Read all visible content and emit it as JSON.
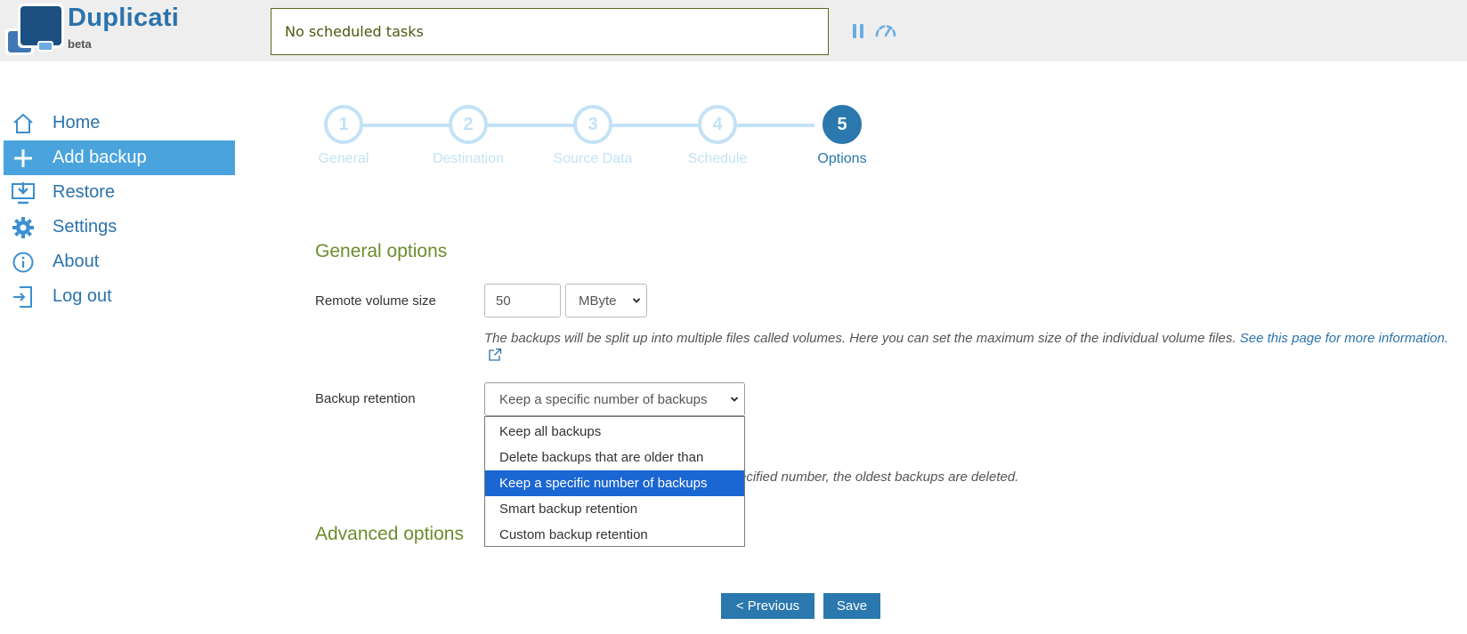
{
  "header": {
    "brand": "Duplicati",
    "brand_sub": "beta",
    "status": "No scheduled tasks"
  },
  "sidebar": {
    "items": [
      {
        "label": "Home",
        "icon": "home-icon"
      },
      {
        "label": "Add backup",
        "icon": "plus-icon",
        "active": true
      },
      {
        "label": "Restore",
        "icon": "restore-icon"
      },
      {
        "label": "Settings",
        "icon": "gear-icon"
      },
      {
        "label": "About",
        "icon": "info-icon"
      },
      {
        "label": "Log out",
        "icon": "logout-icon"
      }
    ]
  },
  "steps": [
    {
      "number": "1",
      "label": "General"
    },
    {
      "number": "2",
      "label": "Destination"
    },
    {
      "number": "3",
      "label": "Source Data"
    },
    {
      "number": "4",
      "label": "Schedule"
    },
    {
      "number": "5",
      "label": "Options",
      "current": true
    }
  ],
  "general": {
    "title": "General options",
    "volume_label": "Remote volume size",
    "volume_value": "50",
    "volume_unit": "MByte",
    "help_text": "The backups will be split up into multiple files called volumes. Here you can set the maximum size of the individual volume files.",
    "help_link": "See this page for more information.",
    "retention_label": "Backup retention",
    "retention_value": "Keep a specific number of backups",
    "retention_options": [
      "Keep all backups",
      "Delete backups that are older than",
      "Keep a specific number of backups",
      "Smart backup retention",
      "Custom backup retention"
    ],
    "retention_selected_index": 2,
    "retention_help": "ecified number, the oldest backups are deleted."
  },
  "advanced": {
    "title": "Advanced options"
  },
  "buttons": {
    "previous": "< Previous",
    "save": "Save"
  },
  "colors": {
    "accent": "#2a78ad",
    "active_nav": "#4aa3dc",
    "section_title": "#6d8c2e",
    "inactive_step": "#c3e2f6",
    "dropdown_selected": "#1a66d2"
  }
}
